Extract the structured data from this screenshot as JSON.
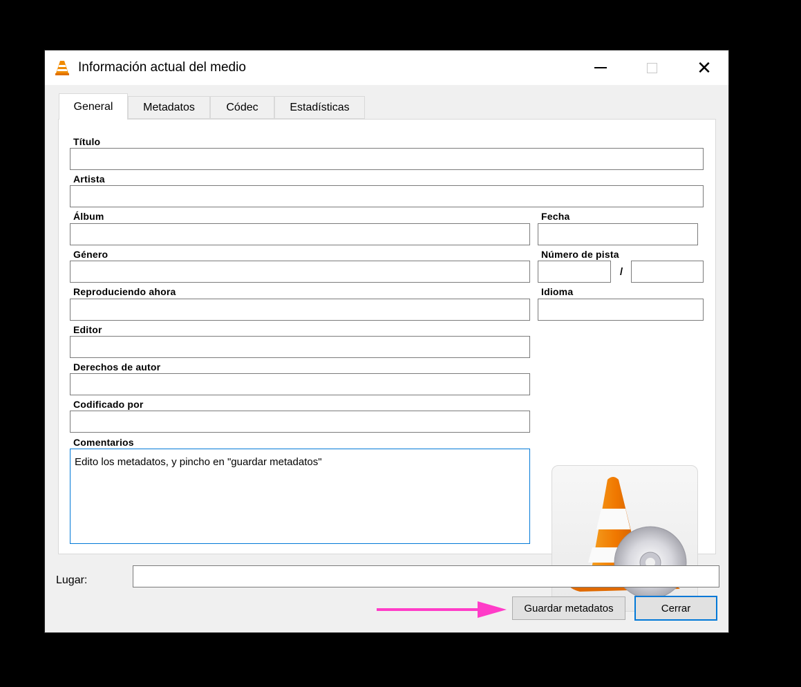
{
  "window": {
    "title": "Información actual del medio"
  },
  "tabs": [
    {
      "label": "General",
      "active": true
    },
    {
      "label": "Metadatos",
      "active": false
    },
    {
      "label": "Códec",
      "active": false
    },
    {
      "label": "Estadísticas",
      "active": false
    }
  ],
  "fields": {
    "titulo": {
      "label": "Título",
      "value": ""
    },
    "artista": {
      "label": "Artista",
      "value": ""
    },
    "album": {
      "label": "Álbum",
      "value": ""
    },
    "fecha": {
      "label": "Fecha",
      "value": ""
    },
    "genero": {
      "label": "Género",
      "value": ""
    },
    "numero_pista": {
      "label": "Número de pista",
      "separator": "/",
      "value": "",
      "total": ""
    },
    "reproduciendo": {
      "label": "Reproduciendo ahora",
      "value": ""
    },
    "idioma": {
      "label": "Idioma",
      "value": ""
    },
    "editor": {
      "label": "Editor",
      "value": ""
    },
    "derechos": {
      "label": "Derechos de autor",
      "value": ""
    },
    "codificado": {
      "label": "Codificado por",
      "value": ""
    },
    "comentarios": {
      "label": "Comentarios",
      "value": "Edito los metadatos, y pincho en \"guardar metadatos\""
    }
  },
  "lugar": {
    "label": "Lugar:",
    "value": ""
  },
  "buttons": {
    "save": "Guardar metadatos",
    "close": "Cerrar"
  },
  "colors": {
    "accent": "#0078d7",
    "annotation_arrow": "#ff3cc8",
    "vlc_orange": "#f08a00"
  }
}
